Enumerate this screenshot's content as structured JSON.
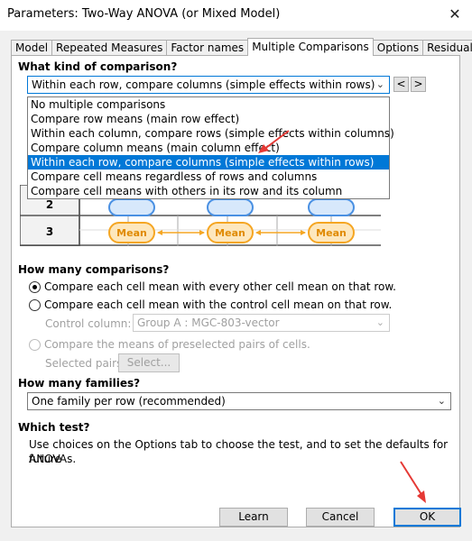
{
  "window": {
    "title": "Parameters: Two-Way ANOVA (or Mixed Model)",
    "close_glyph": "✕"
  },
  "tabs": [
    {
      "label": "Model"
    },
    {
      "label": "Repeated Measures"
    },
    {
      "label": "Factor names"
    },
    {
      "label": "Multiple Comparisons",
      "active": true
    },
    {
      "label": "Options"
    },
    {
      "label": "Residuals"
    }
  ],
  "comparison_kind": {
    "heading": "What kind of comparison?",
    "selected": "Within each row, compare columns (simple effects within rows)",
    "prev_label": "<",
    "next_label": ">",
    "options": [
      "No multiple comparisons",
      "Compare row means (main row effect)",
      "Within each column, compare rows (simple effects within columns)",
      "Compare column means (main column effect)",
      "Within each row, compare columns (simple effects within rows)",
      "Compare cell means regardless of rows and columns",
      "Compare cell means with others in its row and its column"
    ],
    "selected_index": 4
  },
  "diagram": {
    "row_labels": [
      "2",
      "3"
    ],
    "cell_label": "Mean",
    "accent_color": "#f5a623",
    "blue_color": "#4a90e2"
  },
  "how_many_comparisons": {
    "heading": "How many comparisons?",
    "option_every": "Compare each cell mean with every other cell mean on that row.",
    "option_control": "Compare each cell mean with the control cell mean on that row.",
    "control_column_label": "Control column:",
    "control_column_value": "Group A : MGC-803-vector",
    "option_preselected": "Compare the means of preselected pairs of cells.",
    "selected_pairs_label": "Selected pairs:",
    "select_button": "Select..."
  },
  "families": {
    "heading": "How many families?",
    "value": "One family per row (recommended)"
  },
  "which_test": {
    "heading": "Which test?",
    "text_line1": "Use choices on the Options tab to choose the test, and to set the defaults for future",
    "text_line2": "ANOVAs."
  },
  "buttons": {
    "learn": "Learn",
    "cancel": "Cancel",
    "ok": "OK"
  },
  "annotation_color": "#e53935"
}
